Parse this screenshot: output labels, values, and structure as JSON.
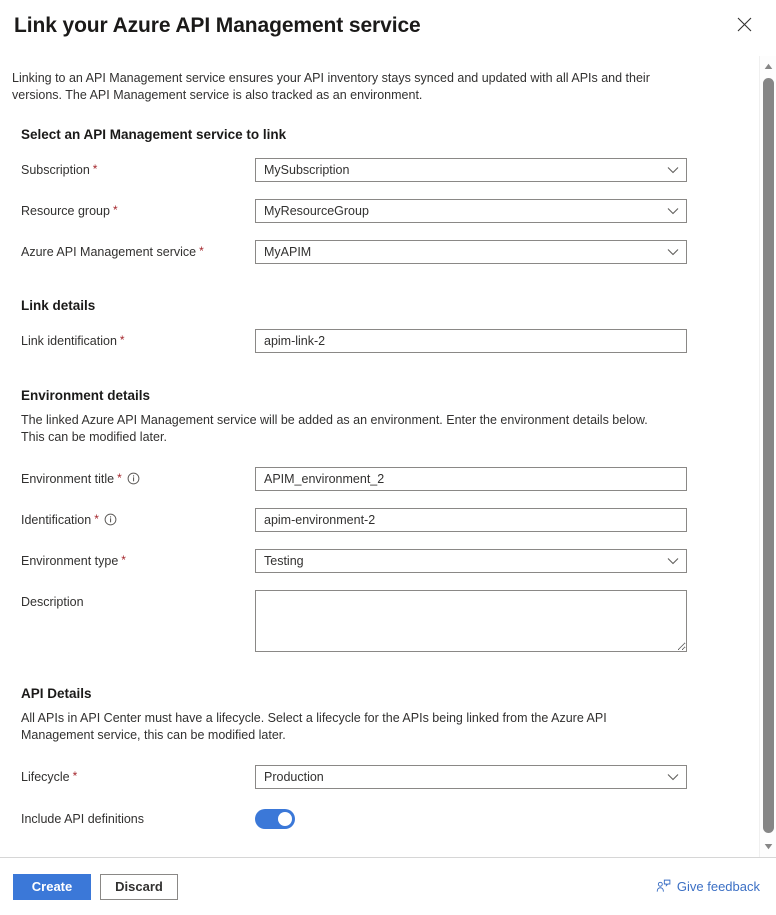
{
  "header": {
    "title": "Link your Azure API Management service",
    "close_icon": "close-icon"
  },
  "intro": "Linking to an API Management service ensures your API inventory stays synced and updated with all APIs and their versions. The API Management service is also tracked as an environment.",
  "sections": {
    "service": {
      "heading": "Select an API Management service to link",
      "fields": {
        "subscription": {
          "label": "Subscription",
          "required": "*",
          "value": "MySubscription"
        },
        "resource_group": {
          "label": "Resource group",
          "required": "*",
          "value": "MyResourceGroup"
        },
        "apim_service": {
          "label": "Azure API Management service",
          "required": "*",
          "value": "MyAPIM"
        }
      }
    },
    "link_details": {
      "heading": "Link details",
      "fields": {
        "link_identification": {
          "label": "Link identification",
          "required": "*",
          "value": "apim-link-2"
        }
      }
    },
    "environment_details": {
      "heading": "Environment details",
      "note": "The linked Azure API Management service will be added as an environment. Enter the environment details below. This can be modified later.",
      "fields": {
        "environment_title": {
          "label": "Environment title",
          "required": "*",
          "info": "info-icon",
          "value": "APIM_environment_2"
        },
        "identification": {
          "label": "Identification",
          "required": "*",
          "info": "info-icon",
          "value": "apim-environment-2"
        },
        "environment_type": {
          "label": "Environment type",
          "required": "*",
          "value": "Testing"
        },
        "description": {
          "label": "Description",
          "value": "",
          "placeholder": ""
        }
      }
    },
    "api_details": {
      "heading": "API Details",
      "note": "All APIs in API Center must have a lifecycle. Select a lifecycle for the APIs being linked from the Azure API Management service, this can be modified later.",
      "fields": {
        "lifecycle": {
          "label": "Lifecycle",
          "required": "*",
          "value": "Production"
        },
        "include_api_definitions": {
          "label": "Include API definitions",
          "value": "On"
        }
      }
    }
  },
  "footer": {
    "create_label": "Create",
    "discard_label": "Discard",
    "feedback_label": "Give feedback",
    "feedback_icon": "feedback-person-icon"
  },
  "scrollbar": {
    "up_icon": "caret-up-icon",
    "down_icon": "caret-down-icon"
  },
  "colors": {
    "accent": "#3b78d8",
    "required": "#a4262c",
    "link": "#3b6fc4",
    "border": "#8a8886"
  }
}
